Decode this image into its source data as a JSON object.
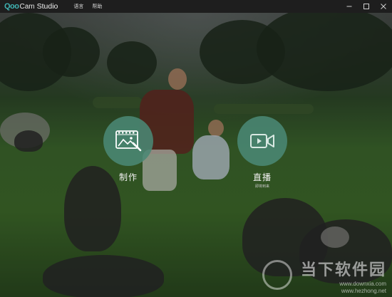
{
  "app": {
    "logo_mark": "Qoo",
    "logo_rest": "Cam",
    "logo_studio": "Studio"
  },
  "menu": {
    "language": "语言",
    "help": "帮助"
  },
  "actions": {
    "create_label": "制作",
    "live_label": "直播",
    "live_sub": "即将到来"
  },
  "watermark": {
    "main": "当下软件园",
    "url1": "www.downxia.com",
    "url2": "www.hezhong.net"
  },
  "colors": {
    "accent": "#3fb3b3",
    "circle": "#4a8874",
    "titlebar": "#1e1e1e"
  },
  "icons": {
    "create": "image-edit-icon",
    "live": "video-camera-icon",
    "minimize": "minimize-icon",
    "maximize": "maximize-icon",
    "close": "close-icon"
  }
}
